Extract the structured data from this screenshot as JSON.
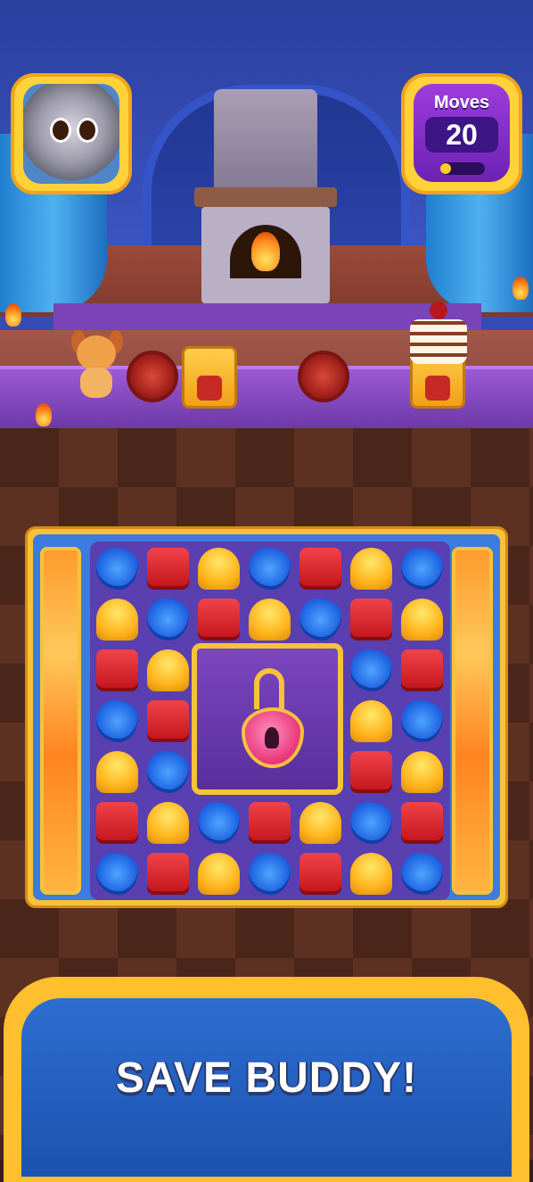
{
  "hud": {
    "moves_label": "Moves",
    "moves_value": "20",
    "moves_progress": 0.0,
    "avatar": "cat-avatar-icon"
  },
  "stage": {
    "items": [
      "dog-character-icon",
      "barrel-icon",
      "crate-icon",
      "barrel-icon",
      "crate-icon",
      "cake-icon"
    ]
  },
  "board": {
    "rows": 7,
    "cols": 7,
    "grid": [
      [
        "blue",
        "red",
        "yellow",
        "blue",
        "red",
        "yellow",
        "blue"
      ],
      [
        "yellow",
        "blue",
        "red",
        "yellow",
        "blue",
        "red",
        "yellow"
      ],
      [
        "red",
        "yellow",
        "lock",
        "lock",
        "lock",
        "blue",
        "red"
      ],
      [
        "blue",
        "red",
        "lock",
        "lock",
        "lock",
        "yellow",
        "blue"
      ],
      [
        "yellow",
        "blue",
        "lock",
        "lock",
        "lock",
        "red",
        "yellow"
      ],
      [
        "red",
        "yellow",
        "blue",
        "red",
        "yellow",
        "blue",
        "red"
      ],
      [
        "blue",
        "red",
        "yellow",
        "blue",
        "red",
        "yellow",
        "blue"
      ]
    ],
    "piece_colors": {
      "red": "#e02a33",
      "yellow": "#ffb41c",
      "blue": "#2a74f0"
    },
    "lock_icon": "padlock-icon"
  },
  "banner": {
    "text": "SAVE BUDDY!"
  },
  "colors": {
    "frame_gold": "#ffd23a",
    "moves_purple": "#8a30cc",
    "banner_blue": "#2460c0"
  }
}
